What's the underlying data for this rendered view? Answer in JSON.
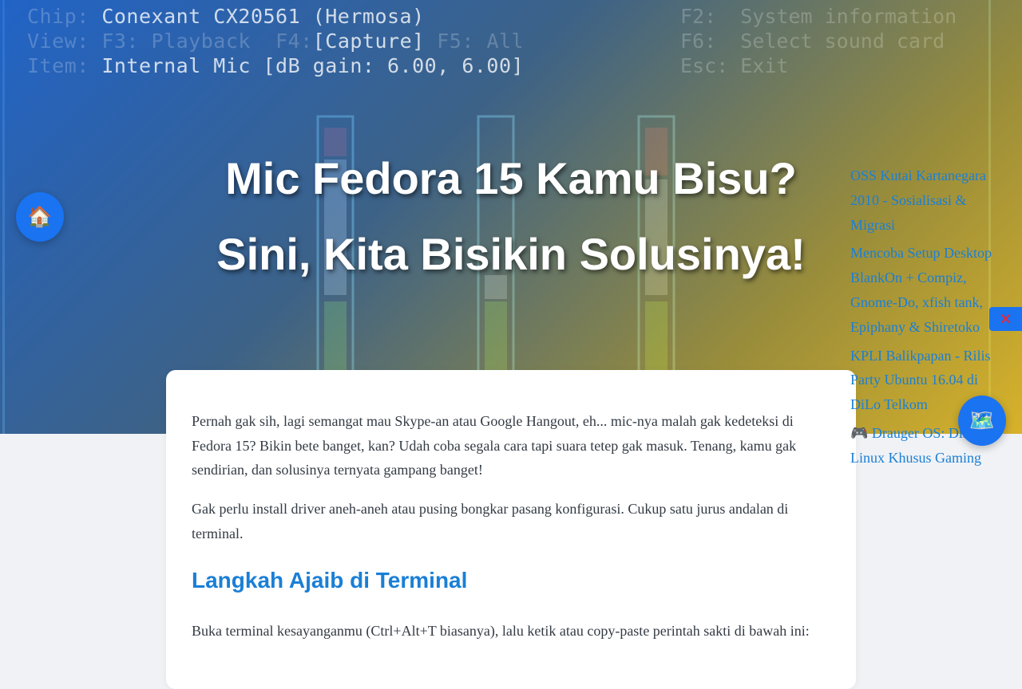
{
  "hero": {
    "title": "Mic Fedora 15 Kamu Bisu? Sini, Kita Bisikin Solusinya!",
    "background": {
      "chip_label": "Chip:",
      "chip_value": "Conexant CX20561 (Hermosa)",
      "view_label": "View:",
      "view_f3": "F3: Playback",
      "view_f4_key": "F4:",
      "view_f4_value": "[Capture]",
      "view_f5": "F5: All",
      "item_label": "Item:",
      "item_value": "Internal Mic [dB gain: 6.00, 6.00]",
      "key_f2": "F2:  System information",
      "key_f6": "F6:  Select sound card",
      "key_esc": "Esc: Exit"
    }
  },
  "article": {
    "intro": "Pernah gak sih, lagi semangat mau Skype-an atau Google Hangout, eh... mic-nya malah gak kedeteksi di Fedora 15? Bikin bete banget, kan? Udah coba segala cara tapi suara tetep gak masuk. Tenang, kamu gak sendirian, dan solusinya ternyata gampang banget!",
    "para2": "Gak perlu install driver aneh-aneh atau pusing bongkar pasang konfigurasi. Cukup satu jurus andalan di terminal.",
    "heading": "Langkah Ajaib di Terminal",
    "para3": "Buka terminal kesayanganmu (Ctrl+Alt+T biasanya), lalu ketik atau copy-paste perintah sakti di bawah ini:"
  },
  "sidebar": {
    "links": [
      "OSS Kutai Kartanegara 2010 - Sosialisasi & Migrasi",
      "Mencoba Setup Desktop BlankOn + Compiz, Gnome-Do, xfish tank, Epiphany & Shiretoko",
      "KPLI Balikpapan - Rilis Party Ubuntu 16.04 di DiLo Telkom",
      "🎮 Drauger OS: Distro Linux Khusus Gaming"
    ]
  },
  "buttons": {
    "home_icon": "🏠",
    "map_icon": "🗺️",
    "close_icon": "✕"
  },
  "colors": {
    "accent": "#1a7fd6",
    "fab": "#1a73f0",
    "close": "#e8283a"
  }
}
